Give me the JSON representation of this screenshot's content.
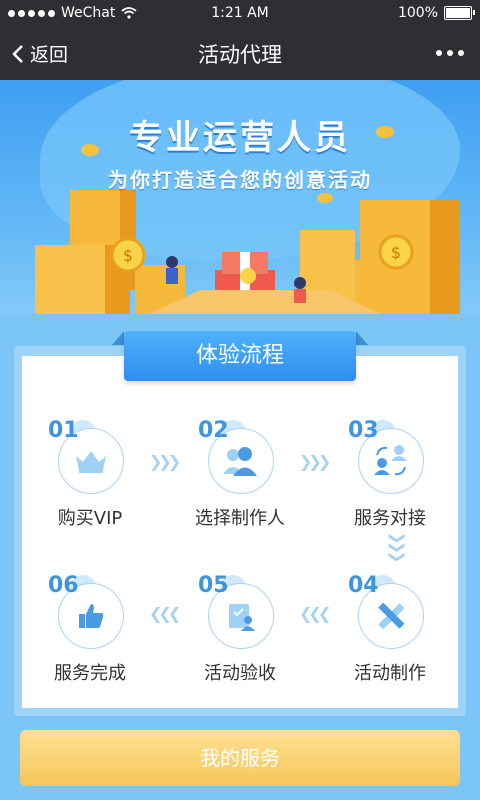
{
  "status": {
    "carrier": "WeChat",
    "time": "1:21 AM",
    "battery": "100%"
  },
  "nav": {
    "back_label": "返回",
    "title": "活动代理"
  },
  "banner": {
    "headline": "专业运营人员",
    "subline": "为你打造适合您的创意活动"
  },
  "process": {
    "title": "体验流程",
    "steps": [
      {
        "num": "01",
        "label": "购买VIP",
        "icon": "crown-icon"
      },
      {
        "num": "02",
        "label": "选择制作人",
        "icon": "users-icon"
      },
      {
        "num": "03",
        "label": "服务对接",
        "icon": "exchange-people-icon"
      },
      {
        "num": "04",
        "label": "活动制作",
        "icon": "pencil-ruler-icon"
      },
      {
        "num": "05",
        "label": "活动验收",
        "icon": "clipboard-person-icon"
      },
      {
        "num": "06",
        "label": "服务完成",
        "icon": "thumbs-up-icon"
      }
    ]
  },
  "bottom_button": {
    "label": "我的服务"
  },
  "colors": {
    "nav_bg": "#2f2f33",
    "accent_blue": "#3f95e0",
    "button_gold": "#f6c75a"
  }
}
